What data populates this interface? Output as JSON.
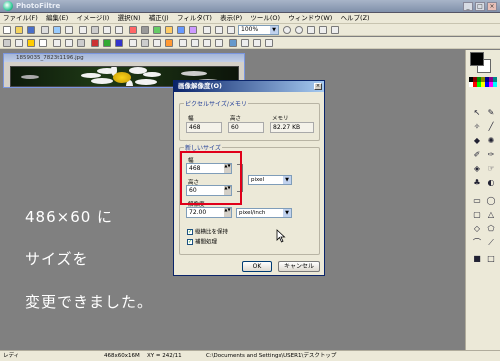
{
  "window": {
    "title": "PhotoFiltre",
    "min": "_",
    "max": "□",
    "close": "×"
  },
  "menu": [
    "ファイル(F)",
    "編集(E)",
    "イメージ(I)",
    "選択(N)",
    "補正(J)",
    "フィルタ(T)",
    "表示(P)",
    "ツール(O)",
    "ウィンドウ(W)",
    "ヘルプ(Z)"
  ],
  "toolbar": {
    "zoom": "100%",
    "zoom_arrow": "▼"
  },
  "image_window": {
    "title": "1859035_7823t1196.jpg"
  },
  "dialog": {
    "title": "画像解像度(O)",
    "close": "×",
    "pixel_group": "ピクセルサイズ/メモリ",
    "width_label": "幅",
    "height_label": "高さ",
    "memory_label": "メモリ",
    "cur_width": "468",
    "cur_height": "60",
    "memory": "82.27 KB",
    "new_group": "新しいサイズ",
    "new_width": "468",
    "new_height": "60",
    "unit": "pixel",
    "res_label": "解像度",
    "resolution": "72.00",
    "res_unit": "pixel/inch",
    "keep_ratio": "縦横比を保持",
    "interpolate": "補間処理",
    "ok": "OK",
    "cancel": "キャンセル",
    "spin": "▲▼",
    "arrow": "▼",
    "check": "✓"
  },
  "overlay": {
    "line1": "486×60 に",
    "line2": "サイズを",
    "line3": "変更できました。"
  },
  "status": {
    "ready": "レディ",
    "size": "468x60x16M",
    "coords": "XY = 242/11",
    "path": "C:\\Documents and Settings\\USER1\\デスクトップ"
  },
  "colors": {
    "highlight": "#e0001a",
    "accent": "#0a246a"
  }
}
